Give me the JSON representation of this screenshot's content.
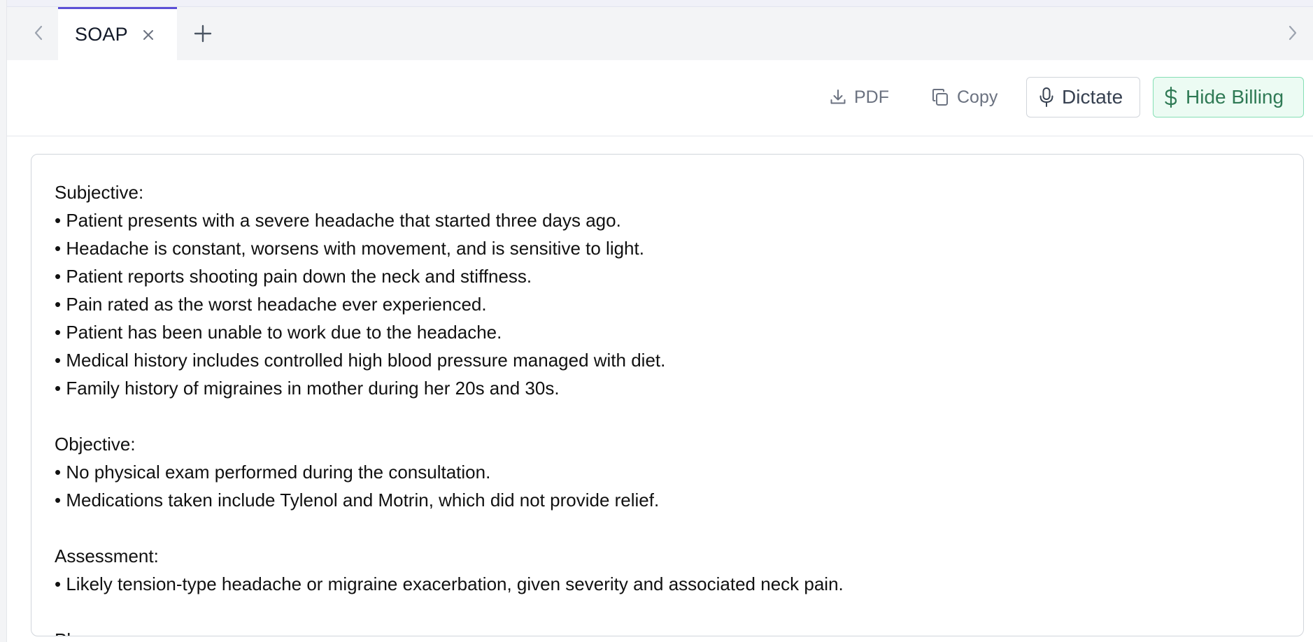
{
  "tabs": {
    "items": [
      {
        "label": "SOAP"
      }
    ],
    "icons": {
      "nav_left": "chevron-left-icon",
      "nav_right": "chevron-right-icon",
      "close": "close-icon",
      "add": "plus-icon"
    }
  },
  "toolbar": {
    "pdf_label": "PDF",
    "copy_label": "Copy",
    "dictate_label": "Dictate",
    "billing_label": "Hide Billing",
    "icons": {
      "pdf": "download-icon",
      "copy": "copy-icon",
      "dictate": "microphone-icon",
      "billing": "dollar-icon"
    }
  },
  "note": {
    "sections": [
      {
        "heading": "Subjective:",
        "bullets": [
          "• Patient presents with a severe headache that started three days ago.",
          "• Headache is constant, worsens with movement, and is sensitive to light.",
          "• Patient reports shooting pain down the neck and stiffness.",
          "• Pain rated as the worst headache ever experienced.",
          "• Patient has been unable to work due to the headache.",
          "• Medical history includes controlled high blood pressure managed with diet.",
          "• Family history of migraines in mother during her 20s and 30s."
        ]
      },
      {
        "heading": "Objective:",
        "bullets": [
          "• No physical exam performed during the consultation.",
          "• Medications taken include Tylenol and Motrin, which did not provide relief."
        ]
      },
      {
        "heading": "Assessment:",
        "bullets": [
          "• Likely tension-type headache or migraine exacerbation, given severity and associated neck pain."
        ]
      },
      {
        "heading": "Plan:",
        "bullets": []
      }
    ]
  },
  "colors": {
    "tab_active_border": "#5b4fd6",
    "billing_bg": "#ecfbf3",
    "billing_border": "#86dfb5",
    "billing_text": "#2f7a55"
  }
}
